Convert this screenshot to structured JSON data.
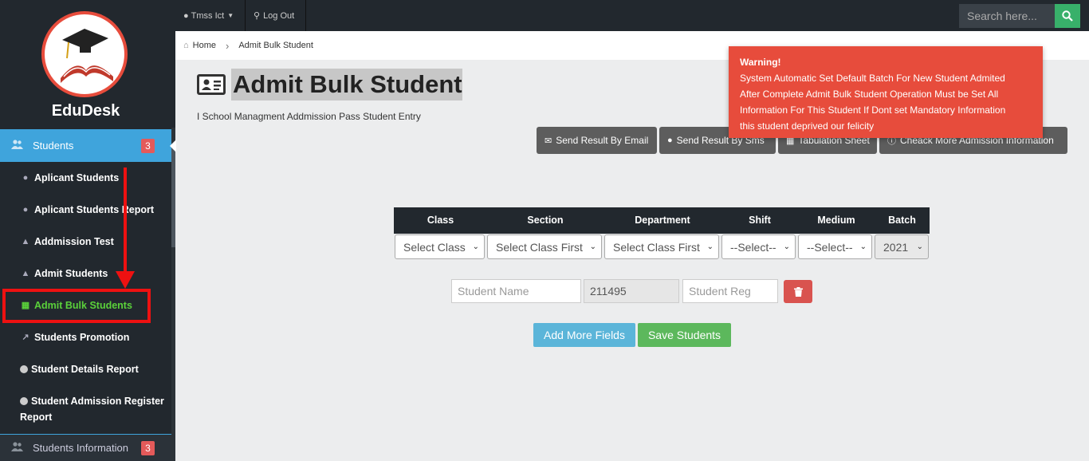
{
  "brand": "EduDesk",
  "topbar": {
    "user_label": "Tmss Ict",
    "logout_label": "Log Out",
    "search_placeholder": "Search here..."
  },
  "breadcrumb": {
    "home": "Home",
    "current": "Admit Bulk Student"
  },
  "sidebar": {
    "active": {
      "label": "Students",
      "badge": "3"
    },
    "items": [
      {
        "label": "Aplicant Students",
        "icon": "user-plus-icon"
      },
      {
        "label": "Aplicant Students Report",
        "icon": "user-plus-icon"
      },
      {
        "label": "Addmission Test",
        "icon": "graduation-cap-icon"
      },
      {
        "label": "Admit Students",
        "icon": "graduation-cap-icon"
      },
      {
        "label": "Admit Bulk Students",
        "icon": "id-card-icon"
      },
      {
        "label": "Students Promotion",
        "icon": "line-chart-icon"
      },
      {
        "label": "Student Details Report",
        "icon": "circle-icon"
      },
      {
        "label": "Student Admission Register",
        "label2": "Report",
        "icon": "circle-icon"
      }
    ],
    "info": {
      "label": "Students Information",
      "badge": "3"
    }
  },
  "page": {
    "title": "Admit Bulk Student",
    "subtitle": "I School Managment Addmission Pass Student Entry"
  },
  "actions": [
    "Send Result By Email",
    "Send Result By Sms",
    "Tabulation Sheet",
    "Cheack More Admission Information"
  ],
  "warning": {
    "title": "Warning!",
    "lines": [
      "System Automatic Set Default Batch For New Student Admited",
      "After Complete Admit Bulk Student Operation Must be Set All",
      "Information For This Student If Dont set Mandatory Information",
      "this student deprived our felicity"
    ]
  },
  "table": {
    "headers": [
      "Class",
      "Section",
      "Department",
      "Shift",
      "Medium",
      "Batch"
    ],
    "selects": [
      "Select Class",
      "Select Class First",
      "Select Class First",
      "--Select--",
      "--Select--",
      "2021"
    ]
  },
  "row": {
    "name_placeholder": "Student Name",
    "id_value": "211495",
    "reg_placeholder": "Student Reg"
  },
  "buttons": {
    "add_more": "Add More Fields",
    "save": "Save Students"
  },
  "colors": {
    "sidebar": "#22282e",
    "active": "#3fa4dc",
    "warning": "#e74c3c",
    "success": "#5cb85c",
    "info": "#5bc0de",
    "danger": "#d9534f"
  }
}
